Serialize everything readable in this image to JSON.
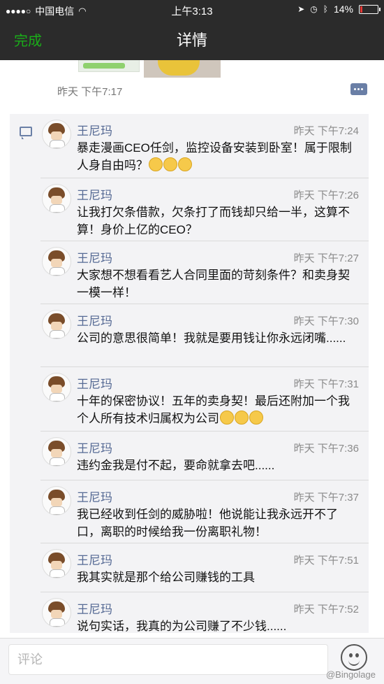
{
  "status_bar": {
    "carrier": "中国电信",
    "time": "上午3:13",
    "battery": "14%",
    "battery_level": 0.14
  },
  "nav": {
    "done_label": "完成",
    "title": "详情"
  },
  "post": {
    "time": "昨天 下午7:17"
  },
  "comments": [
    {
      "name": "王尼玛",
      "time": "昨天 下午7:24",
      "text": "暴走漫画CEO任剑，监控设备安装到卧室！属于限制人身自由吗？",
      "emoji_count": 3
    },
    {
      "name": "王尼玛",
      "time": "昨天 下午7:26",
      "text": "让我打欠条借款，欠条打了而钱却只给一半，这算不算！身价上亿的CEO？",
      "emoji_count": 0
    },
    {
      "name": "王尼玛",
      "time": "昨天 下午7:27",
      "text": "大家想不想看看艺人合同里面的苛刻条件？和卖身契一模一样！",
      "emoji_count": 0
    },
    {
      "name": "王尼玛",
      "time": "昨天 下午7:30",
      "text": "公司的意思很简单！我就是要用钱让你永远闭嘴......",
      "emoji_count": 0
    },
    {
      "name": "王尼玛",
      "time": "昨天 下午7:31",
      "text": "十年的保密协议！五年的卖身契！最后还附加一个我个人所有技术归属权为公司",
      "emoji_count": 3
    },
    {
      "name": "王尼玛",
      "time": "昨天 下午7:36",
      "text": "违约金我是付不起，要命就拿去吧......",
      "emoji_count": 0
    },
    {
      "name": "王尼玛",
      "time": "昨天 下午7:37",
      "text": "我已经收到任剑的威胁啦！他说能让我永远开不了口，离职的时候给我一份离职礼物！",
      "emoji_count": 0
    },
    {
      "name": "王尼玛",
      "time": "昨天 下午7:51",
      "text": "我其实就是那个给公司赚钱的工具",
      "emoji_count": 0
    },
    {
      "name": "王尼玛",
      "time": "昨天 下午7:52",
      "text": "说句实话，我真的为公司赚了不少钱......",
      "emoji_count": 0
    }
  ],
  "input": {
    "placeholder": "评论"
  },
  "watermark": "@Bingolage",
  "colors": {
    "accent_green": "#1aad19",
    "name_blue": "#576b95",
    "bar_dark": "#2b2b2b"
  }
}
